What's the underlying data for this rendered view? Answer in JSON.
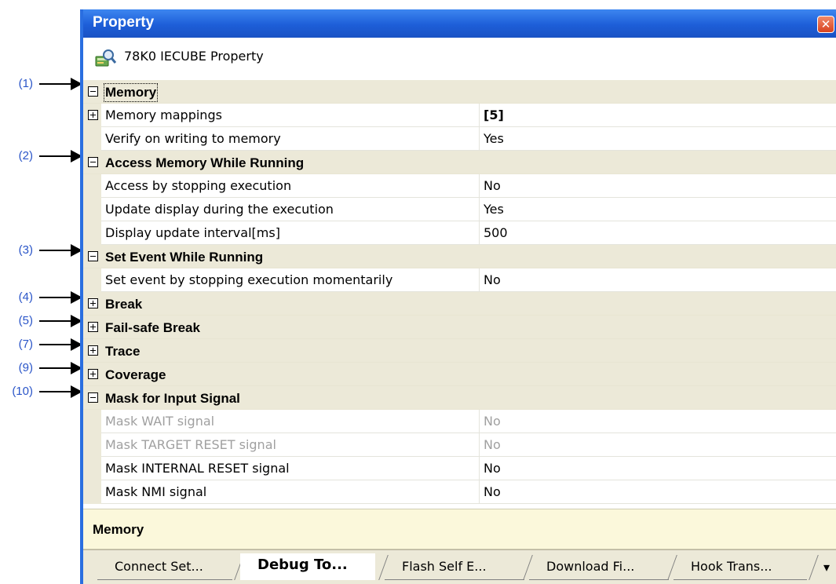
{
  "callouts": [
    "(1)",
    "(2)",
    "(3)",
    "(4)",
    "(5)",
    "(7)",
    "(9)",
    "(10)"
  ],
  "window": {
    "title": "Property",
    "close_glyph": "✕"
  },
  "header": {
    "icon": "property-search-icon",
    "label": "78K0 IECUBE Property"
  },
  "grid": {
    "memory": {
      "label": "Memory",
      "expanded": true
    },
    "memory_mappings": {
      "name": "Memory mappings",
      "value": "[5]"
    },
    "verify": {
      "name": "Verify on writing to memory",
      "value": "Yes"
    },
    "access": {
      "label": "Access Memory While Running",
      "expanded": true
    },
    "access_stop": {
      "name": "Access by stopping execution",
      "value": "No"
    },
    "update_display": {
      "name": "Update display during the execution",
      "value": "Yes"
    },
    "update_interval": {
      "name": "Display update interval[ms]",
      "value": "500"
    },
    "set_event": {
      "label": "Set Event While Running",
      "expanded": true
    },
    "set_event_stop": {
      "name": "Set event by stopping execution momentarily",
      "value": "No"
    },
    "break": {
      "label": "Break",
      "expanded": false
    },
    "failsafe": {
      "label": "Fail-safe Break",
      "expanded": false
    },
    "trace": {
      "label": "Trace",
      "expanded": false
    },
    "coverage": {
      "label": "Coverage",
      "expanded": false
    },
    "mask": {
      "label": "Mask for Input Signal",
      "expanded": true
    },
    "mask_wait": {
      "name": "Mask WAIT signal",
      "value": "No",
      "disabled": true
    },
    "mask_target_reset": {
      "name": "Mask TARGET RESET signal",
      "value": "No",
      "disabled": true
    },
    "mask_internal_reset": {
      "name": "Mask INTERNAL RESET signal",
      "value": "No"
    },
    "mask_nmi": {
      "name": "Mask NMI signal",
      "value": "No"
    }
  },
  "description": {
    "label": "Memory"
  },
  "tabs": [
    {
      "label": "Connect Set...",
      "active": false
    },
    {
      "label": "Debug To...",
      "active": true
    },
    {
      "label": "Flash Self E...",
      "active": false
    },
    {
      "label": "Download Fi...",
      "active": false
    },
    {
      "label": "Hook Trans...",
      "active": false
    }
  ],
  "tab_overflow_glyph": "▾",
  "colors": {
    "title_bar": "#1d5ed8",
    "callout_text": "#2a55c8",
    "category_bg": "#ece9d8",
    "description_bg": "#fbf8db",
    "disabled_text": "#a0a0a0"
  }
}
